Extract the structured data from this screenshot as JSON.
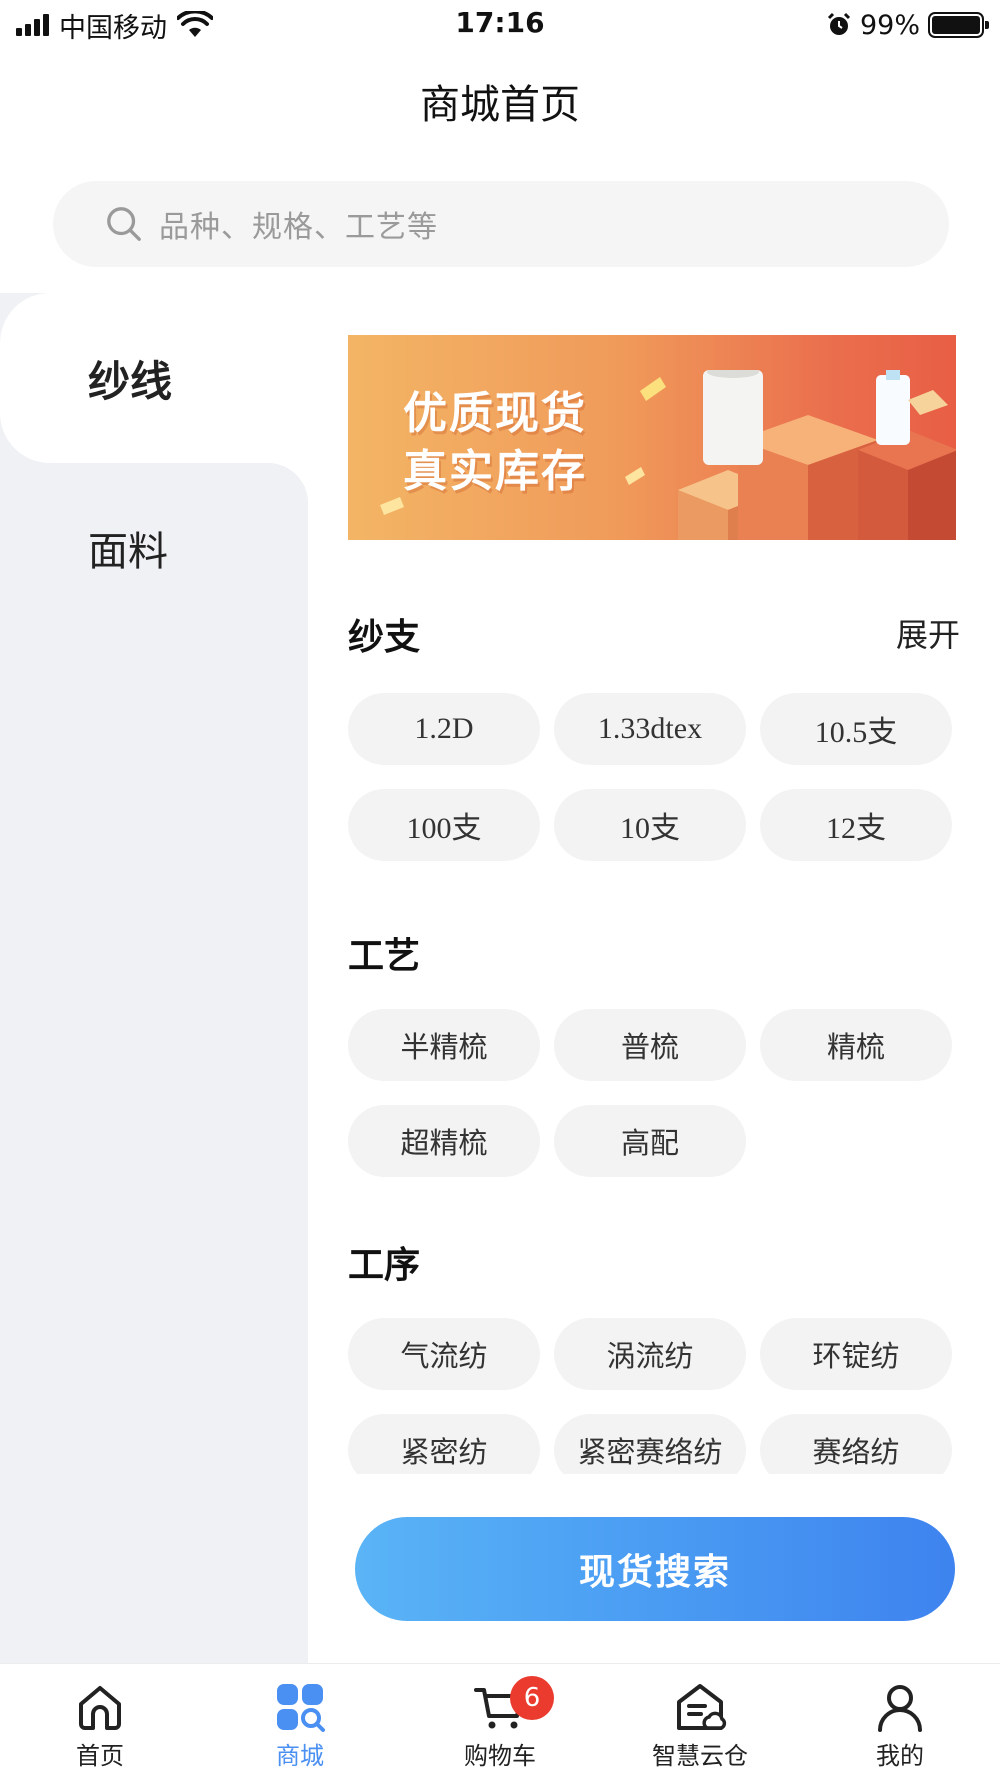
{
  "status_bar": {
    "carrier": "中国移动",
    "time": "17:16",
    "battery_percent": "99%",
    "battery_level": 0.99
  },
  "header": {
    "title": "商城首页"
  },
  "search": {
    "placeholder": "品种、规格、工艺等"
  },
  "sidebar": {
    "items": [
      {
        "label": "纱线",
        "active": true
      },
      {
        "label": "面料",
        "active": false
      }
    ]
  },
  "banner": {
    "line1": "优质现货",
    "line2": "真实库存"
  },
  "sections": [
    {
      "title": "纱支",
      "action": "展开",
      "chips": [
        "1.2D",
        "1.33dtex",
        "10.5支",
        "100支",
        "10支",
        "12支"
      ]
    },
    {
      "title": "工艺",
      "chips": [
        "半精梳",
        "普梳",
        "精梳",
        "超精梳",
        "高配"
      ]
    },
    {
      "title": "工序",
      "chips": [
        "气流纺",
        "涡流纺",
        "环锭纺",
        "紧密纺",
        "紧密赛络纺",
        "赛络纺"
      ]
    }
  ],
  "search_button": {
    "label": "现货搜索"
  },
  "tabbar": {
    "items": [
      {
        "label": "首页",
        "icon": "home-icon",
        "active": false
      },
      {
        "label": "商城",
        "icon": "mall-grid-icon",
        "active": true
      },
      {
        "label": "购物车",
        "icon": "cart-icon",
        "active": false,
        "badge": "6"
      },
      {
        "label": "智慧云仓",
        "icon": "cloud-warehouse-icon",
        "active": false
      },
      {
        "label": "我的",
        "icon": "user-icon",
        "active": false
      }
    ]
  },
  "colors": {
    "accent": "#4a8ff2",
    "sidebar_bg": "#f0f1f5",
    "chip_bg": "#f3f3f3",
    "badge": "#ea3b2e"
  }
}
